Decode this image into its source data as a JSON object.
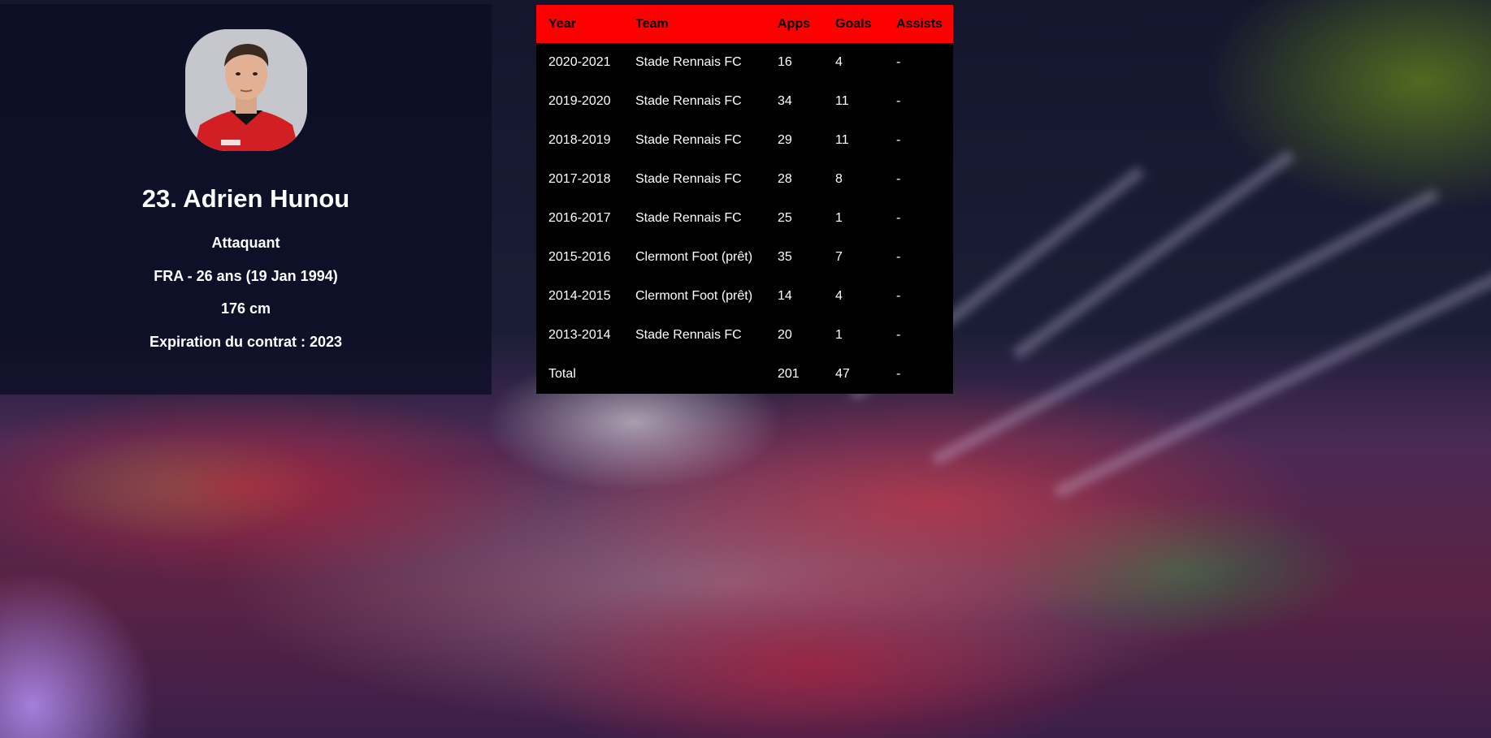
{
  "player": {
    "name": "23. Adrien Hunou",
    "position": "Attaquant",
    "nationality_age": "FRA - 26 ans (19 Jan 1994)",
    "height": "176 cm",
    "contract": "Expiration du contrat : 2023"
  },
  "stats": {
    "headers": [
      "Year",
      "Team",
      "Apps",
      "Goals",
      "Assists"
    ],
    "rows": [
      [
        "2020-2021",
        "Stade Rennais FC",
        "16",
        "4",
        "-"
      ],
      [
        "2019-2020",
        "Stade Rennais FC",
        "34",
        "11",
        "-"
      ],
      [
        "2018-2019",
        "Stade Rennais FC",
        "29",
        "11",
        "-"
      ],
      [
        "2017-2018",
        "Stade Rennais FC",
        "28",
        "8",
        "-"
      ],
      [
        "2016-2017",
        "Stade Rennais FC",
        "25",
        "1",
        "-"
      ],
      [
        "2015-2016",
        "Clermont Foot (prêt)",
        "35",
        "7",
        "-"
      ],
      [
        "2014-2015",
        "Clermont Foot (prêt)",
        "14",
        "4",
        "-"
      ],
      [
        "2013-2014",
        "Stade Rennais FC",
        "20",
        "1",
        "-"
      ],
      [
        "Total",
        "",
        "201",
        "47",
        "-"
      ]
    ]
  },
  "colors": {
    "table_header": "#ff0000",
    "table_body": "#000000",
    "card_overlay": "rgba(10,12,35,0.72)"
  }
}
